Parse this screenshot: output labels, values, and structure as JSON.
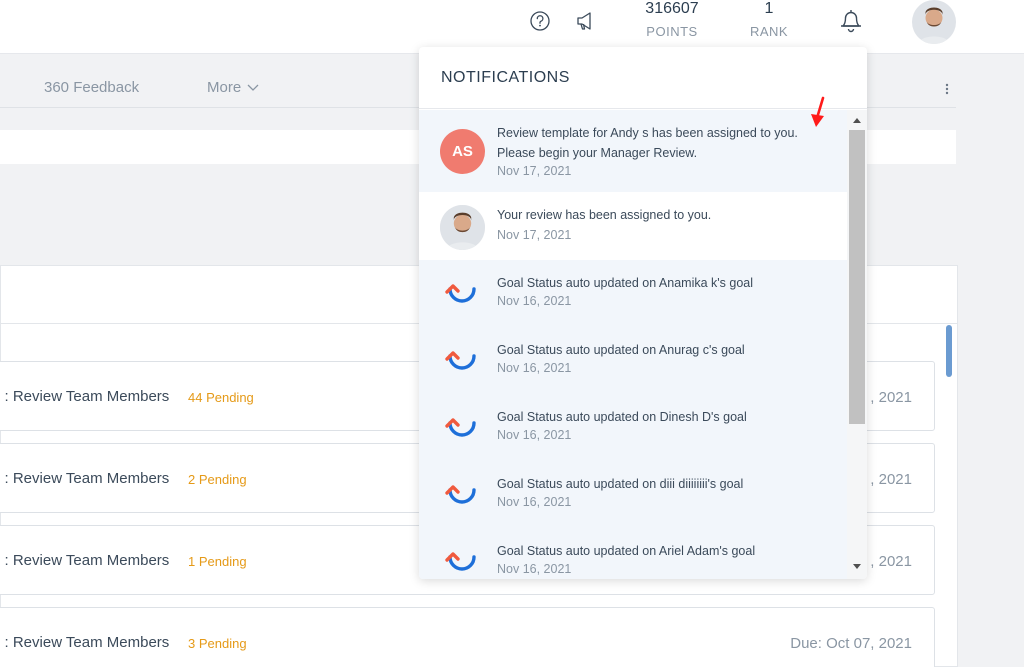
{
  "header": {
    "icons": [
      "help-icon",
      "megaphone-icon",
      "bell-icon"
    ],
    "points_value": "316607",
    "points_label": "POINTS",
    "rank_value": "1",
    "rank_label": "RANK"
  },
  "nav": {
    "tabs": [
      "360 Feedback",
      "More"
    ]
  },
  "tasks": [
    {
      "title": "e : Review Team Members",
      "pending": "44 Pending",
      "due": ", 2021"
    },
    {
      "title": "e : Review Team Members",
      "pending": "2 Pending",
      "due": ", 2021"
    },
    {
      "title": "e : Review Team Members",
      "pending": "1 Pending",
      "due": ", 2021"
    },
    {
      "title": "e : Review Team Members",
      "pending": "3 Pending",
      "due": "Due: Oct 07, 2021"
    }
  ],
  "notifications": {
    "title": "NOTIFICATIONS",
    "items": [
      {
        "initials": "AS",
        "message": "Review template for Andy s has been assigned to you. Please begin your Manager Review.",
        "date": "Nov 17, 2021",
        "icon": "initials-avatar"
      },
      {
        "message": "Your review has been assigned to you.",
        "date": "Nov 17, 2021",
        "icon": "user-avatar"
      },
      {
        "message": "Goal Status auto updated on Anamika k's goal",
        "date": "Nov 16, 2021",
        "icon": "app-logo-icon"
      },
      {
        "message": "Goal Status auto updated on Anurag c's goal",
        "date": "Nov 16, 2021",
        "icon": "app-logo-icon"
      },
      {
        "message": "Goal Status auto updated on Dinesh D's goal",
        "date": "Nov 16, 2021",
        "icon": "app-logo-icon"
      },
      {
        "message": "Goal Status auto updated on diii diiiiiiii's goal",
        "date": "Nov 16, 2021",
        "icon": "app-logo-icon"
      },
      {
        "message": "Goal Status auto updated on Ariel Adam's goal",
        "date": "Nov 16, 2021",
        "icon": "app-logo-icon"
      }
    ]
  },
  "colors": {
    "pending": "#e59a18",
    "initials_bg": "#f07b6f",
    "unread_bg": "#f2f6fb",
    "annotation_arrow": "#ff0000"
  }
}
